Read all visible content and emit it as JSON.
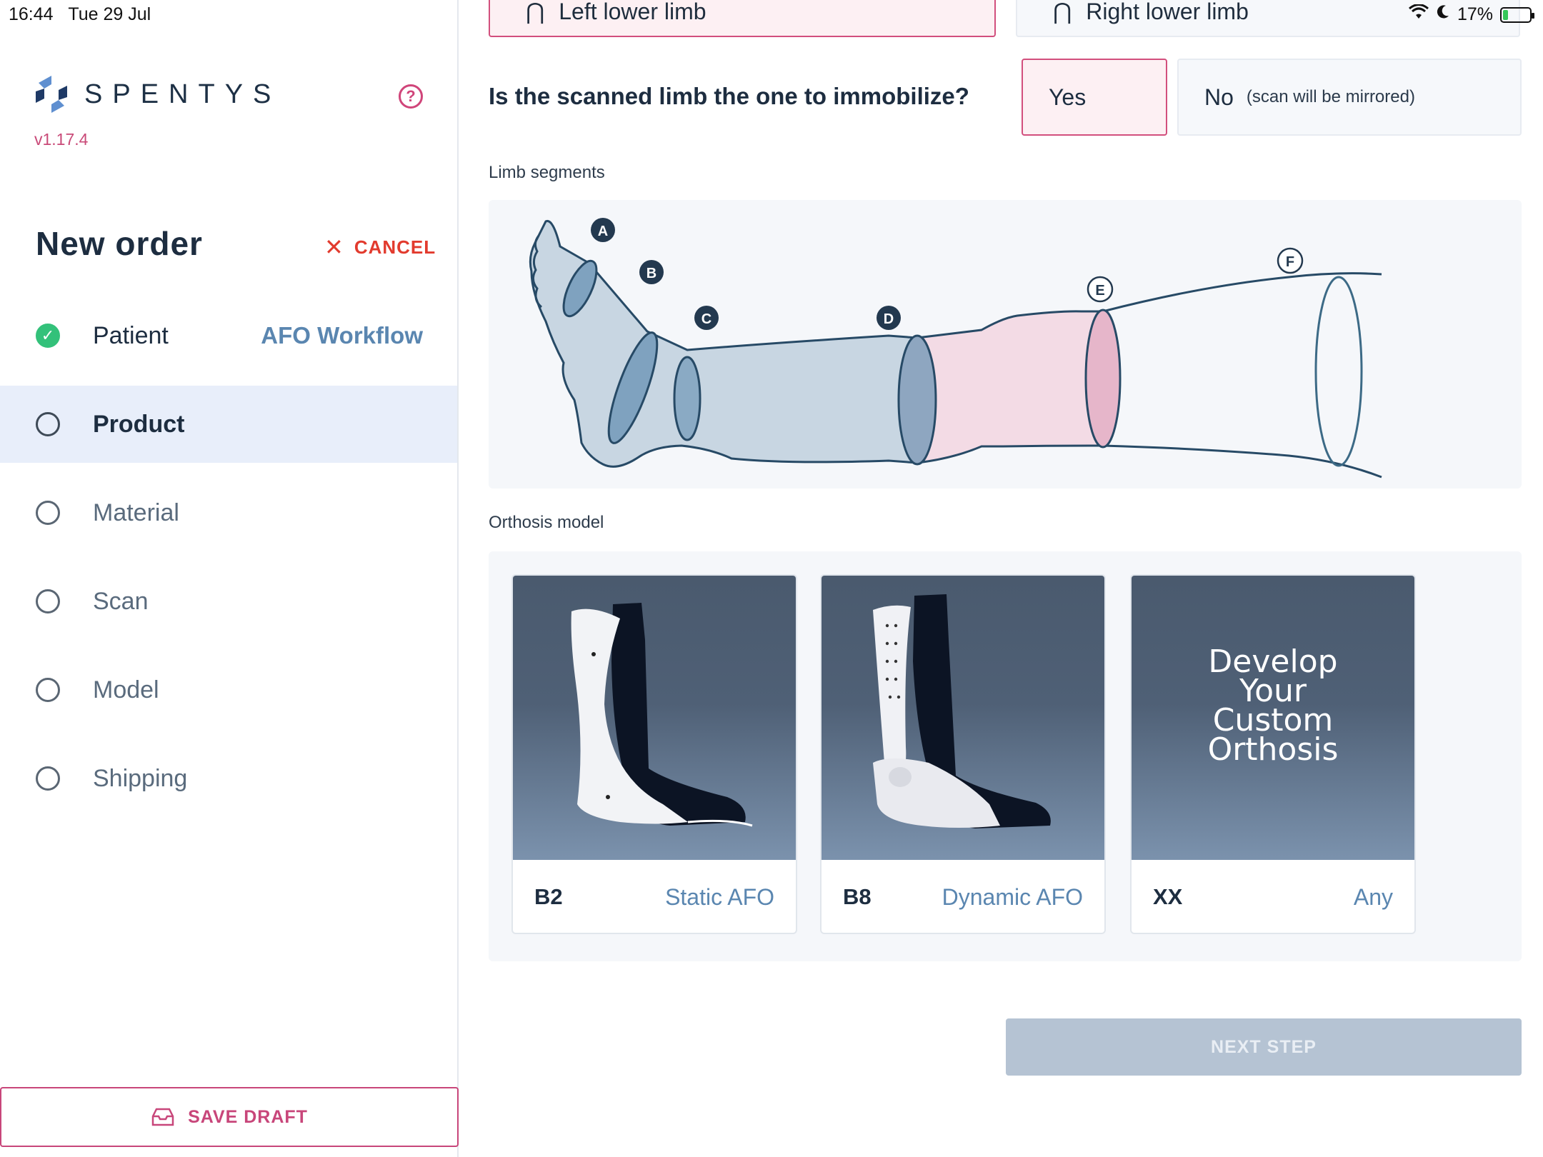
{
  "status": {
    "time": "16:44",
    "date": "Tue 29 Jul",
    "battery": "17%",
    "battery_level": 0.17
  },
  "app": {
    "brand": "SPENTYS",
    "version": "v1.17.4",
    "help": "?"
  },
  "sidebar": {
    "title": "New order",
    "cancel_label": "CANCEL",
    "steps": [
      {
        "label": "Patient",
        "extra": "AFO Workflow",
        "state": "done"
      },
      {
        "label": "Product",
        "state": "active"
      },
      {
        "label": "Material",
        "state": "pending"
      },
      {
        "label": "Scan",
        "state": "pending"
      },
      {
        "label": "Model",
        "state": "pending"
      },
      {
        "label": "Shipping",
        "state": "pending"
      }
    ],
    "save_draft_label": "SAVE DRAFT"
  },
  "main": {
    "limb_left": "Left lower limb",
    "limb_right": "Right lower limb",
    "question": "Is the scanned limb the one to immobilize?",
    "yes_label": "Yes",
    "no_label": "No",
    "no_note": "(scan will be mirrored)",
    "segments_label": "Limb segments",
    "segment_markers": [
      "A",
      "B",
      "C",
      "D",
      "E",
      "F"
    ],
    "orthosis_label": "Orthosis model",
    "models": [
      {
        "code": "B2",
        "type": "Static AFO"
      },
      {
        "code": "B8",
        "type": "Dynamic AFO"
      },
      {
        "code": "XX",
        "type": "Any",
        "image_text": [
          "Develop",
          "Your",
          "Custom",
          "Orthosis"
        ]
      }
    ],
    "next_label": "NEXT STEP"
  },
  "colors": {
    "accent_pink": "#d24f7d",
    "accent_blue": "#5a86b0",
    "cancel_red": "#e23b2e",
    "done_green": "#33c17a",
    "active_bg": "#e8eefa",
    "disabled_button": "#b5c3d3"
  }
}
